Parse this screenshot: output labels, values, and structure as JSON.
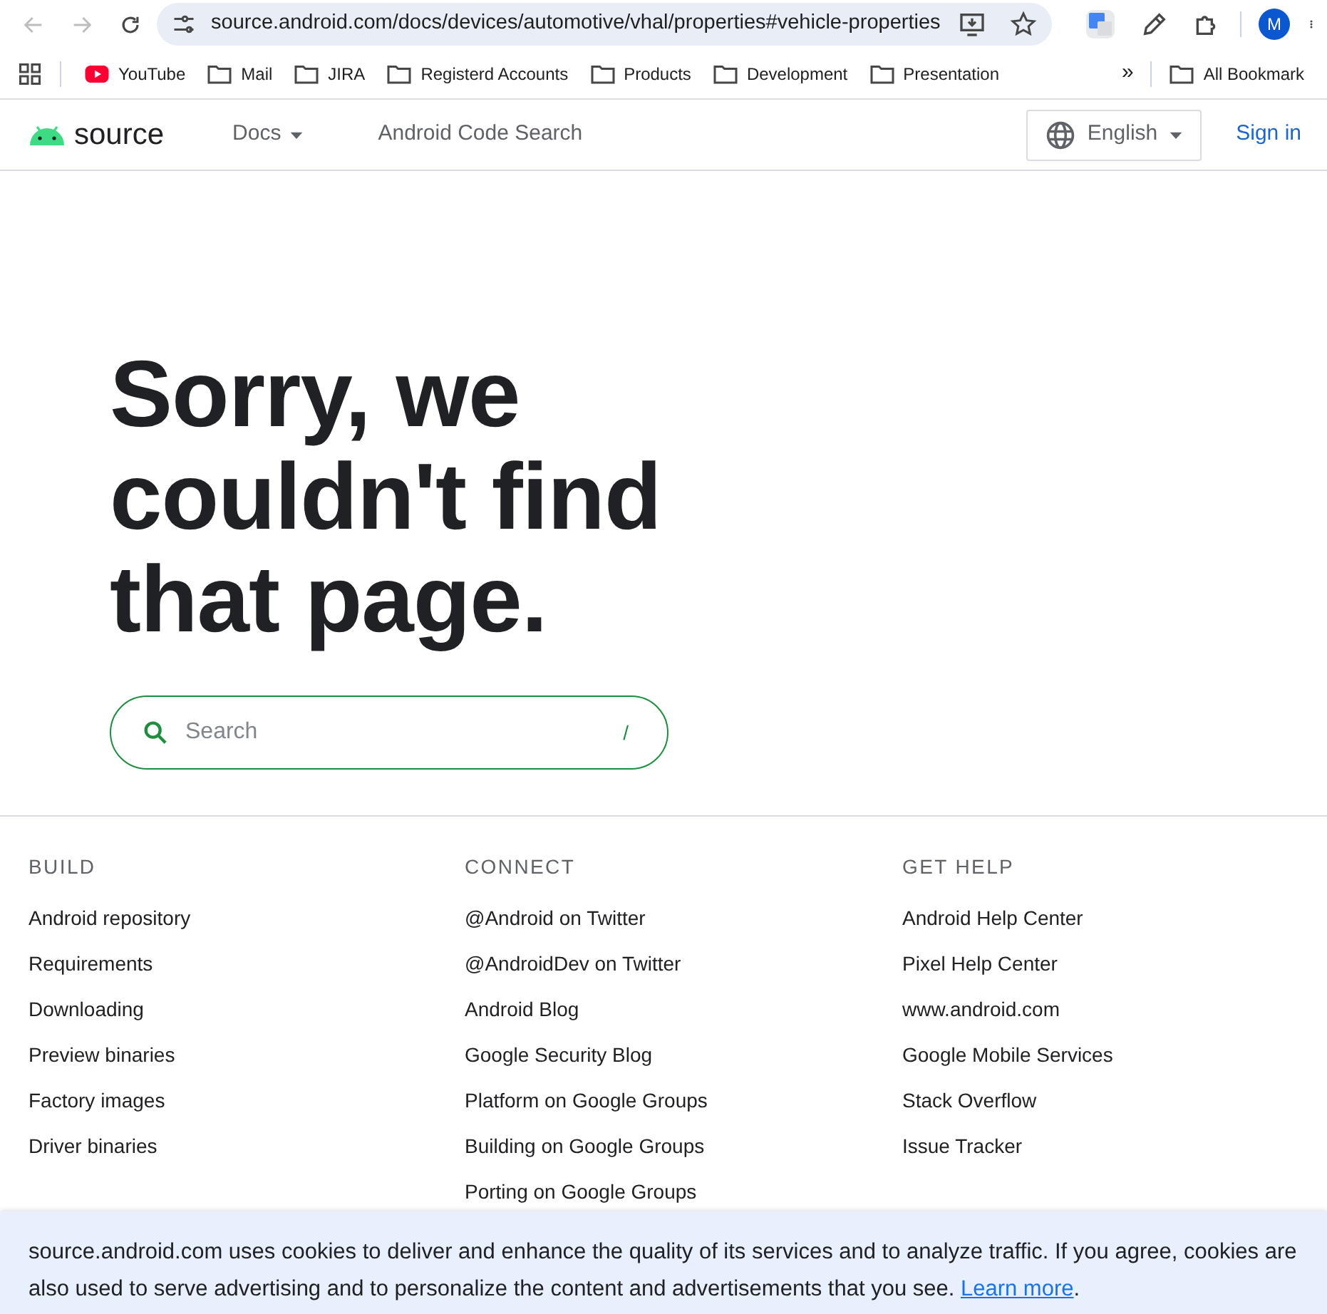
{
  "browser": {
    "nav_buttons": [
      {
        "kind": "back",
        "disabled": true
      },
      {
        "kind": "forward",
        "disabled": true
      },
      {
        "kind": "reload",
        "disabled": false
      }
    ],
    "url": "source.android.com/docs/devices/automotive/vhal/properties#vehicle-properties",
    "profile_initial": "M",
    "bookmarks": [
      {
        "kind": "video",
        "label": "YouTube"
      },
      {
        "kind": "folder",
        "label": "Mail"
      },
      {
        "kind": "folder",
        "label": "JIRA"
      },
      {
        "kind": "folder",
        "label": "Registerd Accounts"
      },
      {
        "kind": "folder",
        "label": "Products"
      },
      {
        "kind": "folder",
        "label": "Development"
      },
      {
        "kind": "folder",
        "label": "Presentation"
      }
    ],
    "overflow": "»",
    "all_bookmarks": "All Bookmark"
  },
  "header": {
    "logo": "source",
    "nav": [
      {
        "label": "Docs",
        "dropdown": true
      },
      {
        "label": "Android Code Search",
        "dropdown": false
      }
    ],
    "language": "English",
    "sign_in": "Sign in"
  },
  "main": {
    "title": "Sorry, we couldn't find that page.",
    "search": {
      "placeholder": "Search",
      "shortcut": "/"
    }
  },
  "footer": [
    {
      "heading": "BUILD",
      "links": [
        "Android repository",
        "Requirements",
        "Downloading",
        "Preview binaries",
        "Factory images",
        "Driver binaries"
      ]
    },
    {
      "heading": "CONNECT",
      "links": [
        "@Android on Twitter",
        "@AndroidDev on Twitter",
        "Android Blog",
        "Google Security Blog",
        "Platform on Google Groups",
        "Building on Google Groups",
        "Porting on Google Groups"
      ]
    },
    {
      "heading": "GET HELP",
      "links": [
        "Android Help Center",
        "Pixel Help Center",
        "www.android.com",
        "Google Mobile Services",
        "Stack Overflow",
        "Issue Tracker"
      ]
    }
  ],
  "cookie_banner": {
    "text": "source.android.com uses cookies to deliver and enhance the quality of its services and to analyze traffic. If you agree, cookies are also used to serve advertising and to personalize the content and advertisements that you see. ",
    "link": "Learn more",
    "after": "."
  }
}
